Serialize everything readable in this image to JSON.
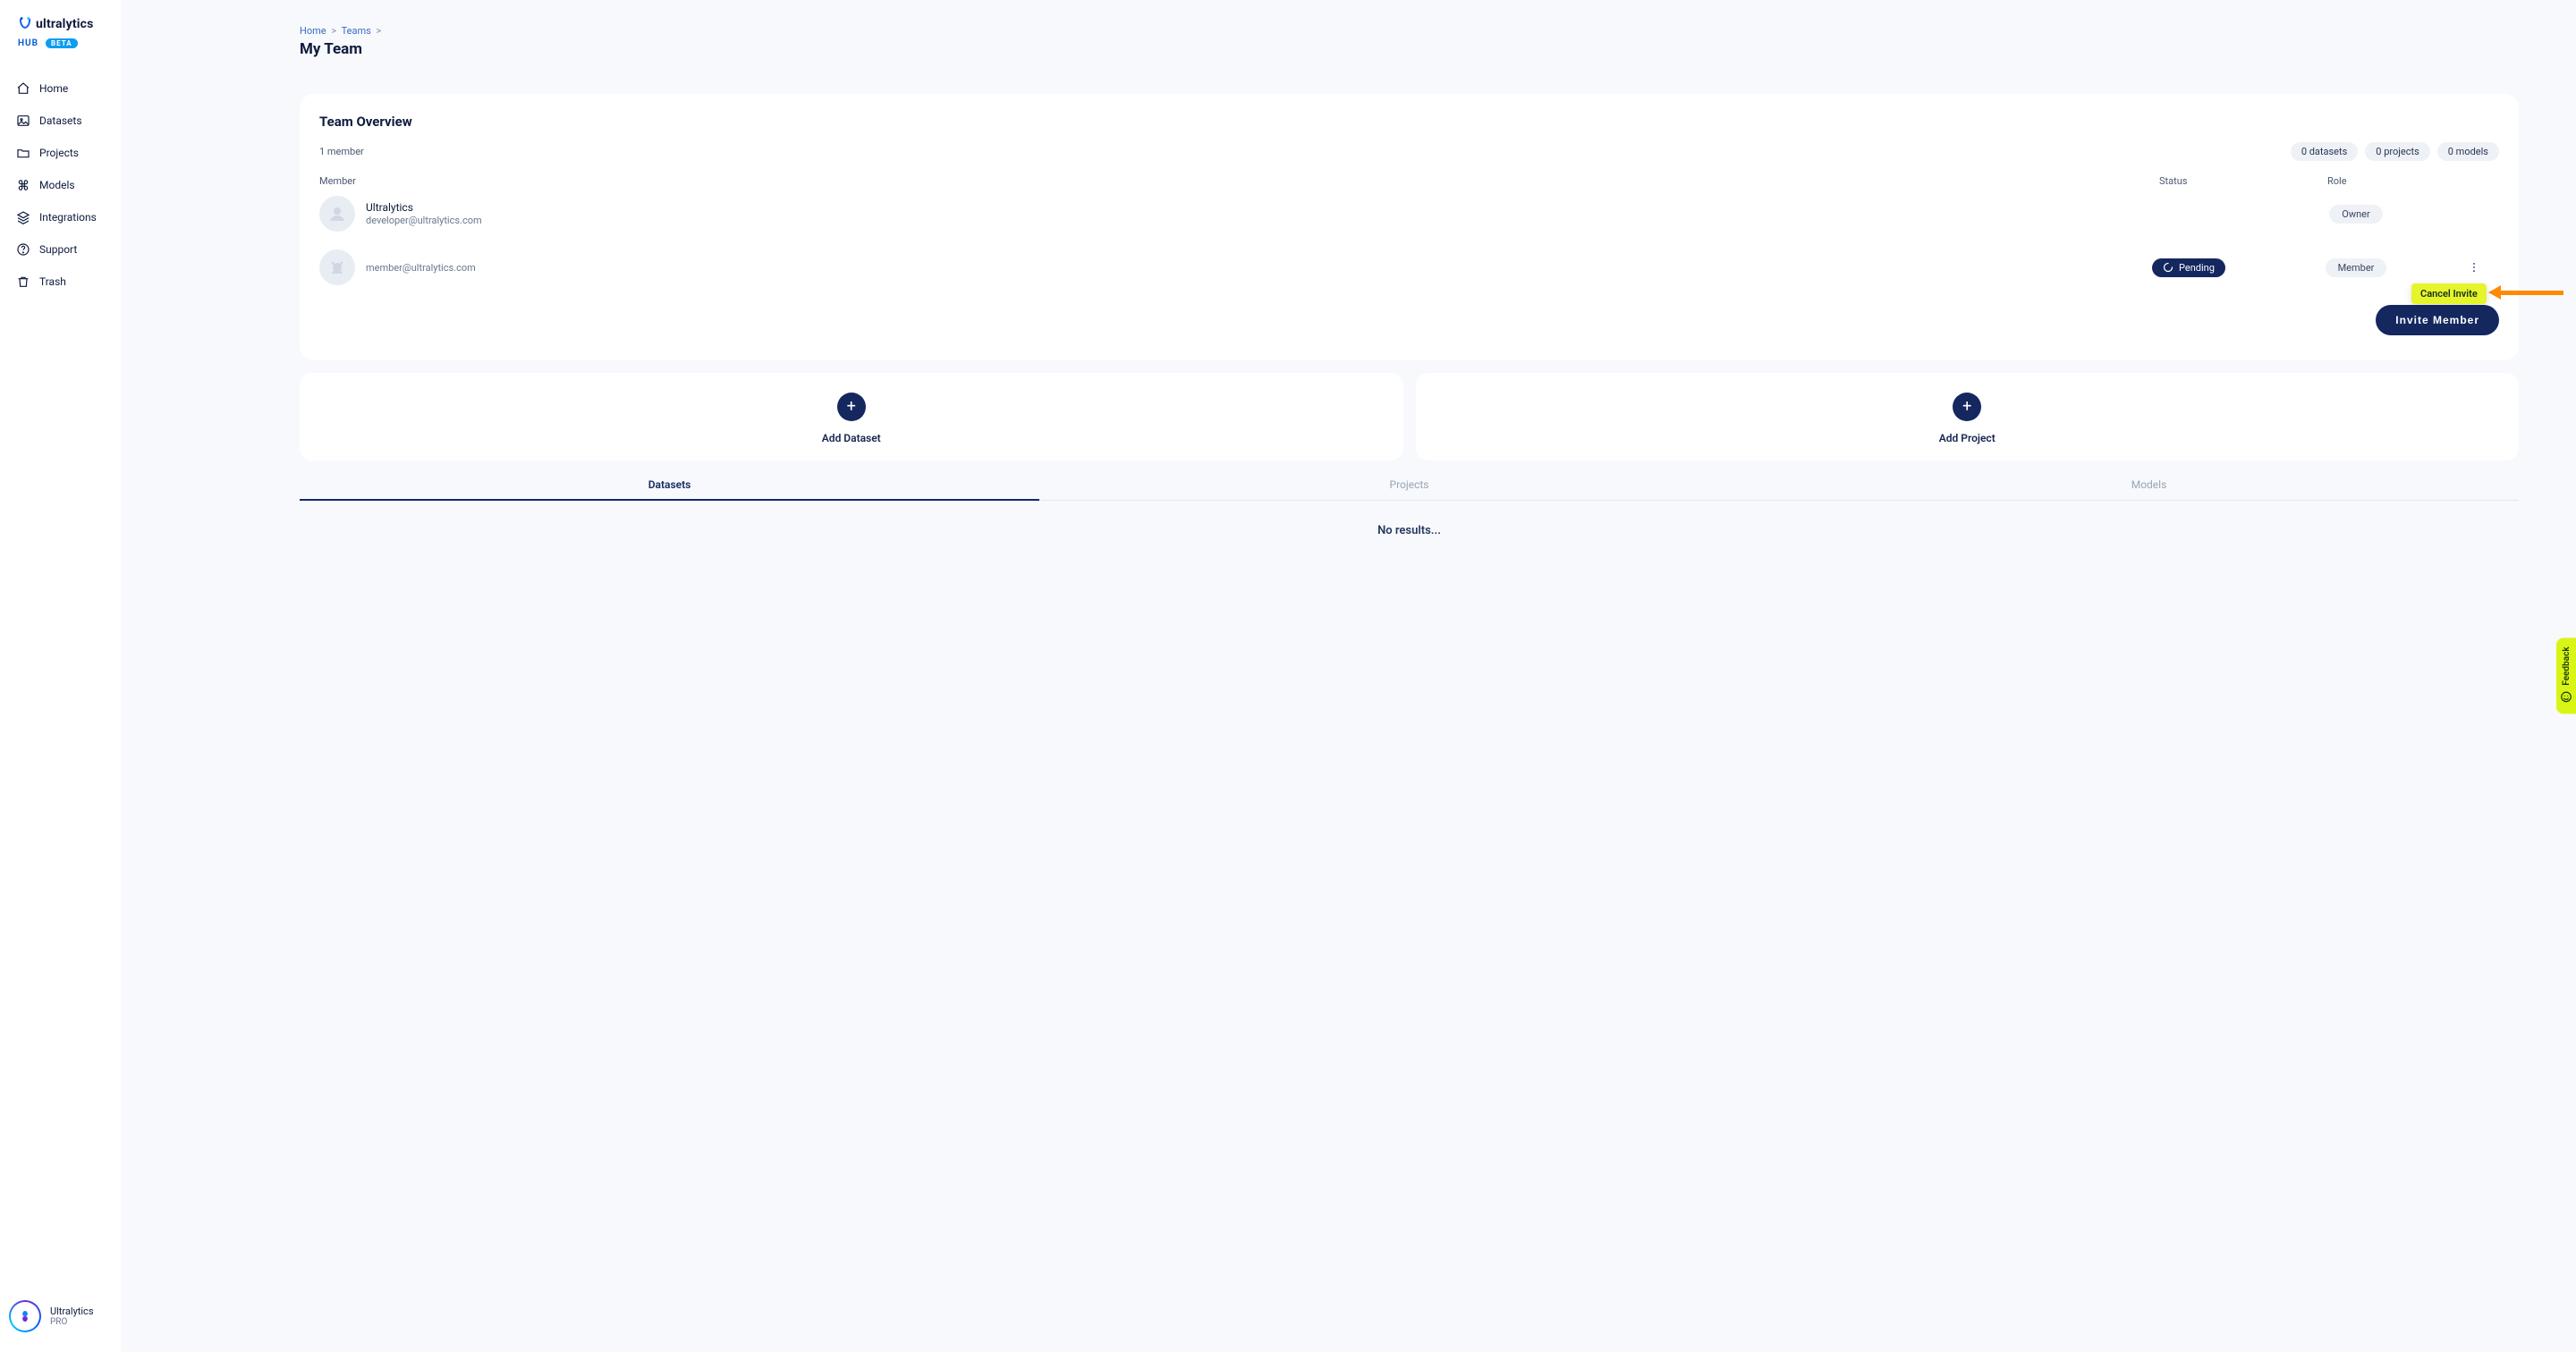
{
  "brand": {
    "name": "ultralytics",
    "sub": "HUB",
    "badge": "BETA"
  },
  "nav": {
    "home": "Home",
    "datasets": "Datasets",
    "projects": "Projects",
    "models": "Models",
    "integrations": "Integrations",
    "support": "Support",
    "trash": "Trash"
  },
  "user": {
    "name": "Ultralytics",
    "plan": "PRO"
  },
  "breadcrumbs": {
    "home": "Home",
    "teams": "Teams"
  },
  "page": {
    "title": "My Team"
  },
  "overview": {
    "heading": "Team Overview",
    "member_count_label": "1 member",
    "pills": {
      "datasets": "0 datasets",
      "projects": "0 projects",
      "models": "0 models"
    },
    "columns": {
      "member": "Member",
      "status": "Status",
      "role": "Role"
    },
    "members": [
      {
        "name": "Ultralytics",
        "email": "developer@ultralytics.com",
        "status": "",
        "role": "Owner"
      },
      {
        "name": "",
        "email": "member@ultralytics.com",
        "status": "Pending",
        "role": "Member"
      }
    ],
    "invite_button": "Invite Member",
    "cancel_invite": "Cancel Invite"
  },
  "add_cards": {
    "dataset": "Add Dataset",
    "project": "Add Project"
  },
  "tabs": {
    "datasets": "Datasets",
    "projects": "Projects",
    "models": "Models"
  },
  "results": {
    "empty": "No results..."
  },
  "feedback": {
    "label": "Feedback"
  }
}
